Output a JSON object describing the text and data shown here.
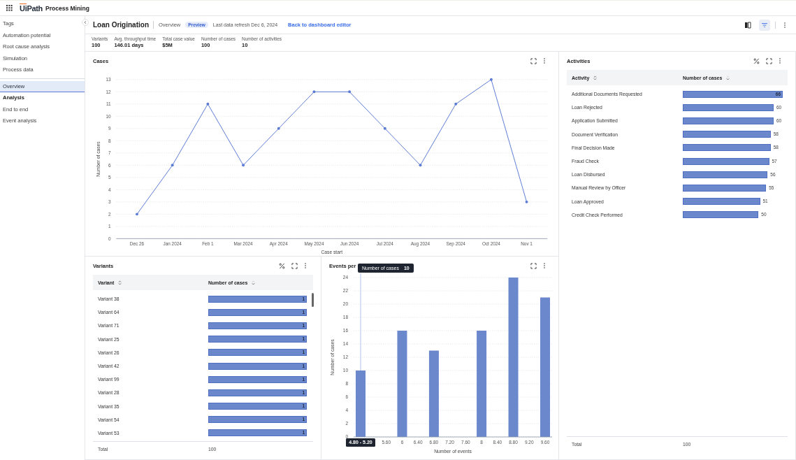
{
  "topbar": {
    "logo_accent": "Ui",
    "logo_rest": "Path",
    "product": "Process Mining"
  },
  "sidebar": {
    "groups": [
      [
        {
          "label": "Tags",
          "kind": "item",
          "selected": false
        },
        {
          "label": "Automation potential",
          "kind": "item",
          "selected": false
        },
        {
          "label": "Root cause analysis",
          "kind": "item",
          "selected": false
        },
        {
          "label": "Simulation",
          "kind": "item",
          "selected": false
        },
        {
          "label": "Process data",
          "kind": "item",
          "selected": false
        }
      ],
      [
        {
          "label": "Overview",
          "kind": "item",
          "selected": true
        },
        {
          "label": "Analysis",
          "kind": "heading"
        },
        {
          "label": "End to end",
          "kind": "item",
          "selected": false
        },
        {
          "label": "Event analysis",
          "kind": "item",
          "selected": false
        }
      ]
    ]
  },
  "header": {
    "title": "Loan Origination",
    "page": "Overview",
    "badge": "Preview",
    "refresh": "Last data refresh Dec 6, 2024",
    "link": "Back to dashboard editor",
    "filter_active": true
  },
  "metrics": [
    {
      "label": "Variants",
      "value": "100"
    },
    {
      "label": "Avg. throughput time",
      "value": "146.01 days"
    },
    {
      "label": "Total case value",
      "value": "$5M"
    },
    {
      "label": "Number of cases",
      "value": "100"
    },
    {
      "label": "Number of activities",
      "value": "10"
    }
  ],
  "cases_panel": {
    "title": "Cases",
    "chart_data": {
      "type": "line",
      "xlabel": "Case start",
      "ylabel": "Number of cases",
      "grid": true,
      "categories": [
        "Dec 26",
        "Jan 2024",
        "Feb 1",
        "Mar 2024",
        "Apr 2024",
        "May 2024",
        "Jun 2024",
        "Jul 2024",
        "Aug 2024",
        "Sep 2024",
        "Oct 2024",
        "Nov 1"
      ],
      "series": [
        {
          "color": "#5b7bd5",
          "values": [
            2,
            6,
            11,
            6,
            9,
            12,
            12,
            9,
            6,
            11,
            13,
            3
          ]
        }
      ],
      "ylim": [
        0,
        13
      ],
      "yticks": [
        0,
        1,
        2,
        3,
        4,
        5,
        6,
        7,
        8,
        9,
        10,
        11,
        12,
        13
      ]
    }
  },
  "activities_panel": {
    "title": "Activities",
    "columns": [
      "Activity",
      "Number of cases"
    ],
    "rows": [
      {
        "name": "Additional Documents Requested",
        "count": "66"
      },
      {
        "name": "Loan Rejected",
        "count": "60"
      },
      {
        "name": "Application Submitted",
        "count": "60"
      },
      {
        "name": "Document Verification",
        "count": "58"
      },
      {
        "name": "Final Decision Made",
        "count": "58"
      },
      {
        "name": "Fraud Check",
        "count": "57"
      },
      {
        "name": "Loan Disbursed",
        "count": "56"
      },
      {
        "name": "Manual Review by Officer",
        "count": "55"
      },
      {
        "name": "Loan Approved",
        "count": "51"
      },
      {
        "name": "Credit Check Performed",
        "count": "50"
      }
    ],
    "total_label": "Total",
    "total_value": "100"
  },
  "variants_panel": {
    "title": "Variants",
    "columns": [
      "Variant",
      "Number of cases"
    ],
    "rows": [
      {
        "name": "Variant 38",
        "count": "1"
      },
      {
        "name": "Variant 64",
        "count": "1"
      },
      {
        "name": "Variant 71",
        "count": "1"
      },
      {
        "name": "Variant 25",
        "count": "1"
      },
      {
        "name": "Variant 26",
        "count": "1"
      },
      {
        "name": "Variant 42",
        "count": "1"
      },
      {
        "name": "Variant 99",
        "count": "1"
      },
      {
        "name": "Variant 28",
        "count": "1"
      },
      {
        "name": "Variant 35",
        "count": "1"
      },
      {
        "name": "Variant 54",
        "count": "1"
      },
      {
        "name": "Variant 53",
        "count": "1"
      }
    ],
    "total_label": "Total",
    "total_value": "100"
  },
  "events_panel": {
    "title": "Events per",
    "tooltip": {
      "value": "10"
    },
    "chart_data": {
      "type": "bar",
      "xlabel": "Number of events",
      "ylabel": "Number of cases",
      "grid": true,
      "categories": [
        "4.80 - 5.20",
        "5.60",
        "6",
        "6.40",
        "6.80",
        "7.20",
        "7.60",
        "8",
        "8.40",
        "8.80",
        "9.20",
        "9.60"
      ],
      "series": [
        {
          "name": "Number of cases",
          "color": "#6b88cc",
          "values": [
            10,
            0,
            16,
            0,
            13,
            0,
            0,
            16,
            0,
            24,
            0,
            21
          ]
        }
      ],
      "ylim": [
        0,
        24
      ],
      "yticks": [
        0,
        2,
        4,
        6,
        8,
        10,
        12,
        14,
        16,
        18,
        20,
        22,
        24
      ]
    }
  }
}
